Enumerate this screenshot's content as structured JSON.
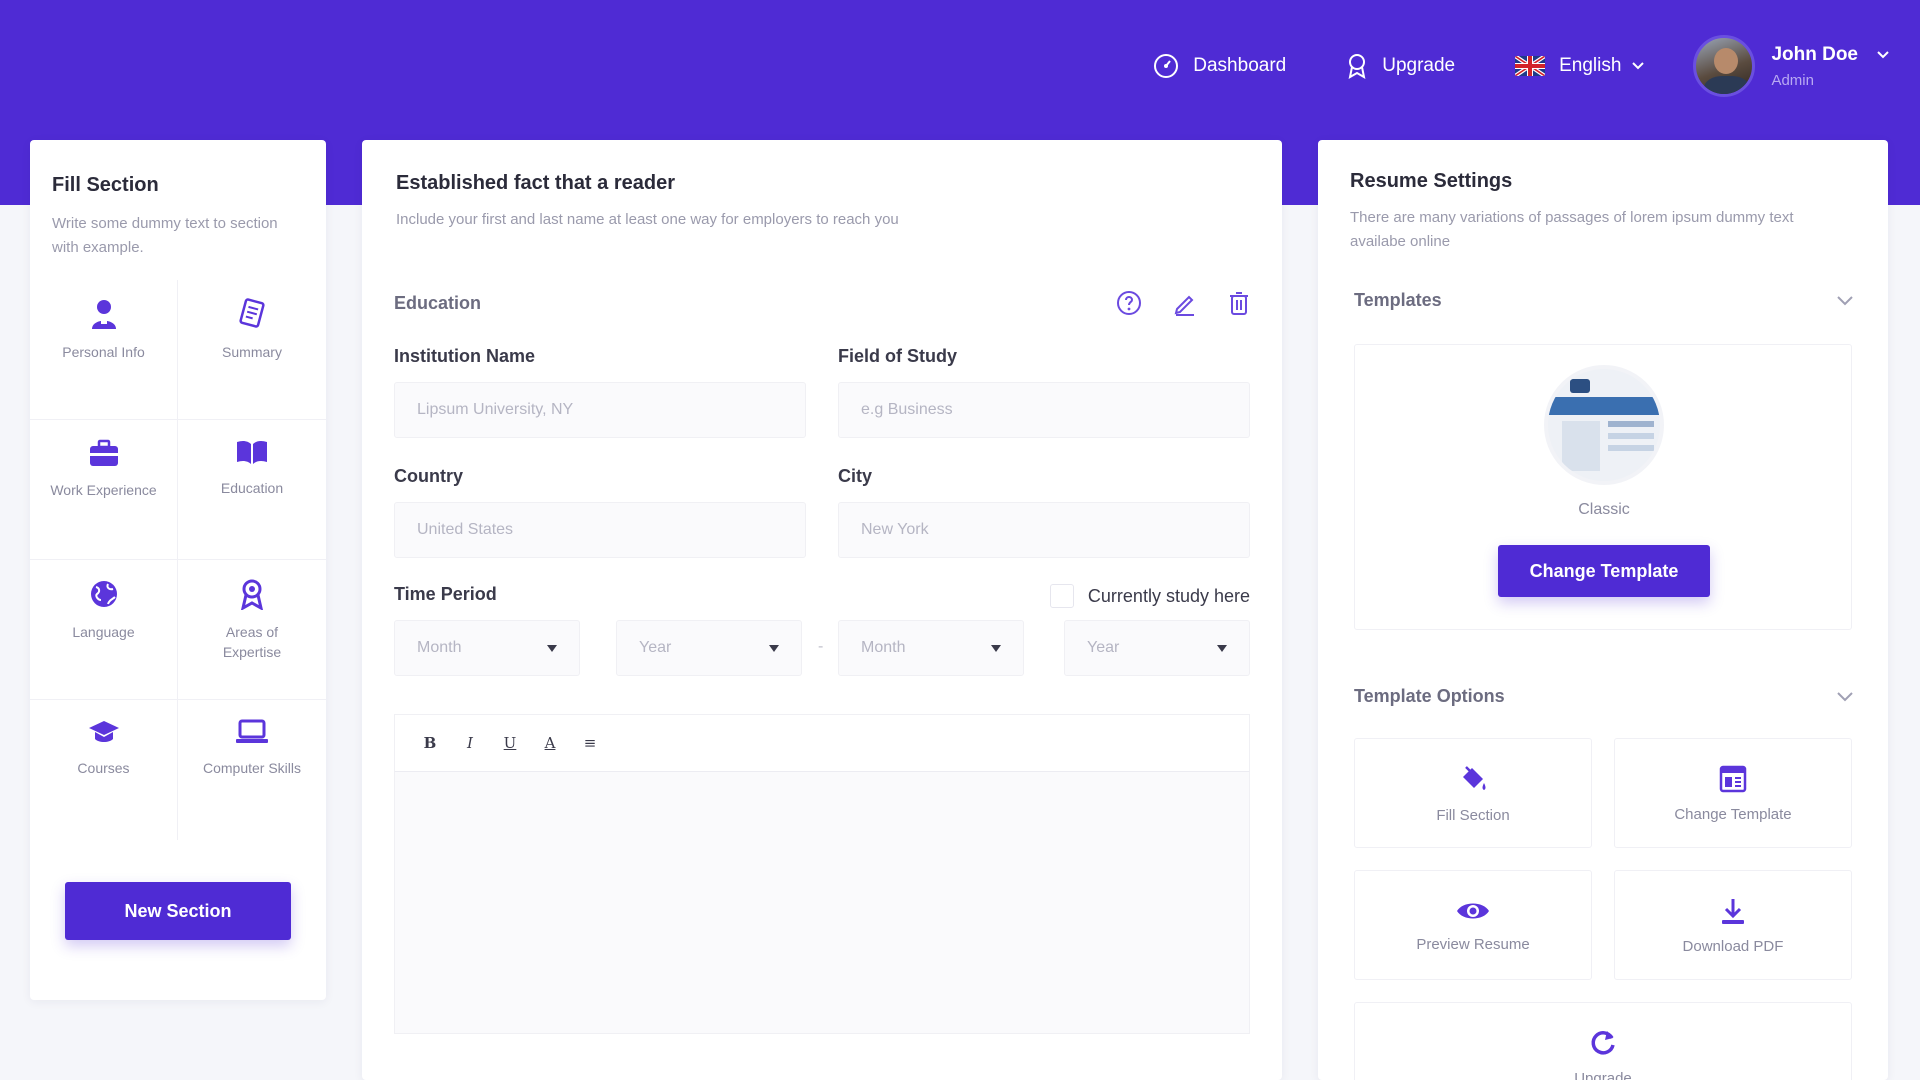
{
  "nav": {
    "dashboard_label": "Dashboard",
    "upgrade_label": "Upgrade",
    "language_label": "English",
    "user_name": "John Doe",
    "user_role": "Admin"
  },
  "left_panel": {
    "title": "Fill Section",
    "subtitle": "Write some dummy text to section with example.",
    "sections": [
      {
        "label": "Personal Info",
        "icon": "user-icon"
      },
      {
        "label": "Summary",
        "icon": "document-icon"
      },
      {
        "label": "Work Experience",
        "icon": "briefcase-icon"
      },
      {
        "label": "Education",
        "icon": "book-icon"
      },
      {
        "label": "Language",
        "icon": "globe-icon"
      },
      {
        "label": "Areas of Expertise",
        "icon": "award-icon"
      },
      {
        "label": "Courses",
        "icon": "graduation-cap-icon"
      },
      {
        "label": "Computer Skills",
        "icon": "laptop-icon"
      }
    ],
    "new_section_label": "New Section"
  },
  "form": {
    "title": "Established fact that a reader",
    "subtitle": "Include your first and last name at least one way for employers to reach you",
    "section_name": "Education",
    "institution_label": "Institution Name",
    "institution_placeholder": "Lipsum University, NY",
    "field_of_study_label": "Field of Study",
    "field_of_study_placeholder": "e.g Business",
    "country_label": "Country",
    "country_placeholder": "United States",
    "city_label": "City",
    "city_placeholder": "New York",
    "time_period_label": "Time Period",
    "start_month": "Month",
    "start_year": "Year",
    "end_month": "Month",
    "end_year": "Year",
    "currently_study_label": "Currently study here",
    "toolbar": [
      "B",
      "I",
      "U",
      "A",
      "≡"
    ]
  },
  "right_panel": {
    "title": "Resume Settings",
    "subtitle": "There are many variations of passages of lorem ipsum dummy text availabe online",
    "templates_label": "Templates",
    "template_name": "Classic",
    "change_template_button": "Change Template",
    "template_options_label": "Template Options",
    "options": [
      {
        "label": "Fill Section",
        "icon": "paint-bucket-icon"
      },
      {
        "label": "Change Template",
        "icon": "layout-icon"
      },
      {
        "label": "Preview Resume",
        "icon": "eye-icon"
      },
      {
        "label": "Download PDF",
        "icon": "download-icon"
      },
      {
        "label": "Upgrade",
        "icon": "refresh-icon"
      }
    ]
  },
  "colors": {
    "brand": "#4f2bd4",
    "background": "#f5f6fa"
  }
}
